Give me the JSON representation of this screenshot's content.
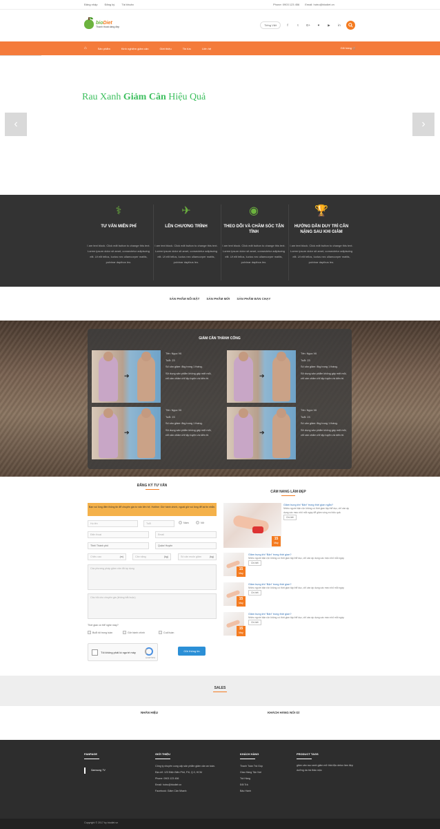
{
  "topbar": {
    "links": [
      "Đăng nhập",
      "Đăng ký",
      "Tài khoản"
    ],
    "phone": "Phone: 0903 123 456",
    "email": "Email: hotro@biodiet.vn"
  },
  "logo": {
    "brand_a": "bio",
    "brand_b": "Diet",
    "tagline": "Thanh thoát dáng đẹp"
  },
  "header": {
    "lang": "Tiếng Việt",
    "search_icon": "search-icon",
    "social": [
      "f",
      "t",
      "G+",
      "♥",
      "▶",
      "in"
    ]
  },
  "nav": {
    "home": "⌂",
    "items": [
      "Sản phẩm",
      "Kinh nghiệm giảm cân",
      "Giới thiệu",
      "Tin tức",
      "Liên hệ"
    ],
    "cart": "Giỏ hàng 🛒"
  },
  "slider": {
    "title_a": "Rau Xanh ",
    "title_b": "Giảm Cân",
    "title_c": " Hiệu Quả",
    "prev": "‹",
    "next": "›"
  },
  "services": [
    {
      "icon": "user-doctor-icon",
      "glyph": "⚕",
      "title": "TƯ VẤN MIỄN PHÍ",
      "text": "I am text block. Click edit button to change this text. Lorem ipsum dolor sit amet, consectetur adipiscing elit. Ut elit tellus, luctus nec ullamcorper mattis, pulvinar dapibus leo."
    },
    {
      "icon": "paper-plane-icon",
      "glyph": "✈",
      "title": "LÊN CHƯƠNG TRÌNH",
      "text": "I am text block. Click edit button to change this text. Lorem ipsum dolor sit amet, consectetur adipiscing elit. Ut elit tellus, luctus nec ullamcorper mattis, pulvinar dapibus leo."
    },
    {
      "icon": "rss-icon",
      "glyph": "◉",
      "title": "THEO DÕI VÀ CHĂM SÓC TẬN TÌNH",
      "text": "I am text block. Click edit button to change this text. Lorem ipsum dolor sit amet, consectetur adipiscing elit. Ut elit tellus, luctus nec ullamcorper mattis, pulvinar dapibus leo."
    },
    {
      "icon": "trophy-icon",
      "glyph": "🏆",
      "title": "HƯỚNG DẪN DUY TRÌ CÂN NẶNG SAU KHI GIẢM",
      "text": "I am text block. Click edit button to change this text. Lorem ipsum dolor sit amet, consectetur adipiscing elit. Ut elit tellus, luctus nec ullamcorper mattis, pulvinar dapibus leo."
    }
  ],
  "product_tabs": [
    "SẢN PHẨM NỔI BẬT",
    "SẢN PHẨM MỚI",
    "SẢN PHẨM BÁN CHẠY"
  ],
  "success": {
    "title": "GIẢM CÂN THÀNH CÔNG",
    "cards": [
      {
        "name": "Tên: Ngọc Vũ",
        "age": "Tuổi: 23",
        "result": "Số cân giảm: 8kg trong 1 tháng.",
        "desc": "Sử dụng sản phẩm không gây mệt mỏi, chỉ cần chăm chỉ tập luyện và kiên trì."
      },
      {
        "name": "Tên: Ngọc Vũ",
        "age": "Tuổi: 23",
        "result": "Số cân giảm: 8kg trong 1 tháng.",
        "desc": "Sử dụng sản phẩm không gây mệt mỏi, chỉ cần chăm chỉ tập luyện và kiên trì."
      },
      {
        "name": "Tên: Ngọc Vũ",
        "age": "Tuổi: 23",
        "result": "Số cân giảm: 8kg trong 1 tháng.",
        "desc": "Sử dụng sản phẩm không gây mệt mỏi, chỉ cần chăm chỉ tập luyện và kiên trì."
      },
      {
        "name": "Tên: Ngọc Vũ",
        "age": "Tuổi: 23",
        "result": "Số cân giảm: 8kg trong 1 tháng.",
        "desc": "Sử dụng sản phẩm không gây mệt mỏi, chỉ cần chăm chỉ tập luyện và kiên trì."
      }
    ]
  },
  "form": {
    "title": "ĐĂNG KÝ TƯ VẤN",
    "notice": "Bạn vui lòng điền thông tin để chuyên gia tư vấn liên hệ. Hotline: Giờ hành chính, ngoài giờ vui lòng để lại tin nhắn.",
    "name_ph": "Họ tên",
    "age_ph": "Tuổi",
    "gender_m": "Nam",
    "gender_f": "Nữ",
    "phone_ph": "Điện thoại",
    "email_ph": "Email",
    "city": "Tỉnh/ Thành phố",
    "district": "Quận/ Huyện",
    "height_ph": "Chiều cao",
    "height_unit": "(m)",
    "weight_ph": "Cân nặng",
    "weight_unit": "(kg)",
    "goal_ph": "Số cân muốn giảm",
    "goal_unit": "(kg)",
    "methods_ph": "Các phương pháp giảm cân đã áp dụng",
    "question_ph": "Câu hỏi cho chuyên gia (không bắt buộc)",
    "time_q": "Thời gian có thể nghe máy?",
    "time_opts": [
      "Buổi tối trong tuần",
      "Giờ hành chính",
      "Cuối tuần"
    ],
    "captcha": "Tôi không phải là người máy",
    "captcha_brand": "reCAPTCHA",
    "submit": "Gửi thông tin"
  },
  "news": {
    "title": "CẨM NANG LÀM ĐẸP",
    "items": [
      {
        "title": "Giảm bụng khi “Bận” trong thời gian ngắn?",
        "excerpt": "Nhiều người bận rộn không có thời gian tập thể dục, chỉ cần áp dụng các mẹo nhỏ mỗi ngày để giảm vòng eo hiệu quả.",
        "day": "15",
        "month": "May",
        "more": "Chi tiết"
      },
      {
        "title": "Giảm bụng khi “Bận” trong thời gian?",
        "excerpt": "Nhiều người bận rộn không có thời gian tập thể dục, chỉ cần áp dụng các mẹo nhỏ mỗi ngày.",
        "day": "15",
        "month": "May",
        "more": "Chi tiết"
      },
      {
        "title": "Giảm bụng khi “Bận” trong thời gian?",
        "excerpt": "Nhiều người bận rộn không có thời gian tập thể dục, chỉ cần áp dụng các mẹo nhỏ mỗi ngày.",
        "day": "15",
        "month": "May",
        "more": "Chi tiết"
      },
      {
        "title": "Giảm bụng khi “Bận” trong thời gian?",
        "excerpt": "Nhiều người bận rộn không có thời gian tập thể dục, chỉ cần áp dụng các mẹo nhỏ mỗi ngày.",
        "day": "15",
        "month": "May",
        "more": "Chi tiết"
      }
    ]
  },
  "sales": {
    "title": "SALES"
  },
  "brands": {
    "left": "NHÃN HIỆU",
    "right": "KHÁCH HÀNG NÓI GÌ"
  },
  "footer": {
    "col1": {
      "title": "FANPAGE",
      "item": "Samsung TV"
    },
    "col2": {
      "title": "GIỚI THIỆU",
      "intro": "Công ty chuyên cung cấp sản phẩm giảm cân an toàn.",
      "lines": [
        "Địa chỉ: 123 Điện Biên Phủ, P.6, Q.3, HCM",
        "Phone: 0903 123 456",
        "Email: hotro@biodiet.vn",
        "Facebook: Giảm Cân Nhanh"
      ]
    },
    "col3": {
      "title": "KHÁCH HÀNG",
      "items": [
        "Thanh Toán Trả Góp",
        "Giao Hàng Tận Nơi",
        "Trả Hàng",
        "Đổi Trả",
        "Bảo Hành"
      ]
    },
    "col4": {
      "title": "PRODUCT TAGS",
      "tags": "giảm cân  rau xanh  giảm mỡ  thải độc  detox  làm đẹp  dưỡng da  trà thảo mộc"
    }
  },
  "copyright": "Copyright © 2017 by biodiet.vn"
}
